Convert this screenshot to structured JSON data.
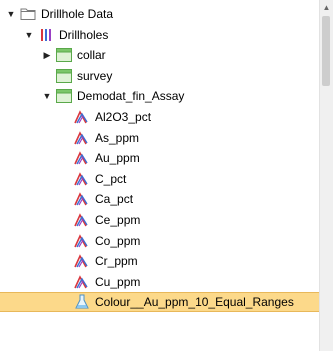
{
  "tree": {
    "items": [
      {
        "label": "Drillhole Data",
        "level": 0,
        "expand": "expanded",
        "icon": "folder-icon",
        "selected": false
      },
      {
        "label": "Drillholes",
        "level": 1,
        "expand": "expanded",
        "icon": "drillholes-icon",
        "selected": false
      },
      {
        "label": "collar",
        "level": 2,
        "expand": "collapsed",
        "icon": "table-icon",
        "selected": false
      },
      {
        "label": "survey",
        "level": 2,
        "expand": "none",
        "icon": "table-icon",
        "selected": false
      },
      {
        "label": "Demodat_fin_Assay",
        "level": 2,
        "expand": "expanded",
        "icon": "table-icon",
        "selected": false
      },
      {
        "label": "Al2O3_pct",
        "level": 3,
        "expand": "none",
        "icon": "numeric-field-icon",
        "selected": false
      },
      {
        "label": "As_ppm",
        "level": 3,
        "expand": "none",
        "icon": "numeric-field-icon",
        "selected": false
      },
      {
        "label": "Au_ppm",
        "level": 3,
        "expand": "none",
        "icon": "numeric-field-icon",
        "selected": false
      },
      {
        "label": "C_pct",
        "level": 3,
        "expand": "none",
        "icon": "numeric-field-icon",
        "selected": false
      },
      {
        "label": "Ca_pct",
        "level": 3,
        "expand": "none",
        "icon": "numeric-field-icon",
        "selected": false
      },
      {
        "label": "Ce_ppm",
        "level": 3,
        "expand": "none",
        "icon": "numeric-field-icon",
        "selected": false
      },
      {
        "label": "Co_ppm",
        "level": 3,
        "expand": "none",
        "icon": "numeric-field-icon",
        "selected": false
      },
      {
        "label": "Cr_ppm",
        "level": 3,
        "expand": "none",
        "icon": "numeric-field-icon",
        "selected": false
      },
      {
        "label": "Cu_ppm",
        "level": 3,
        "expand": "none",
        "icon": "numeric-field-icon",
        "selected": false
      },
      {
        "label": "Colour__Au_ppm_10_Equal_Ranges",
        "level": 3,
        "expand": "none",
        "icon": "flask-icon",
        "selected": true
      }
    ]
  },
  "colors": {
    "selection": "#fcd98a",
    "folder": "#e8c46a",
    "table_green": "#7cc66a",
    "field_red": "#d9363e",
    "field_blue": "#3b6fd4",
    "field_purple": "#9a3fc4"
  }
}
